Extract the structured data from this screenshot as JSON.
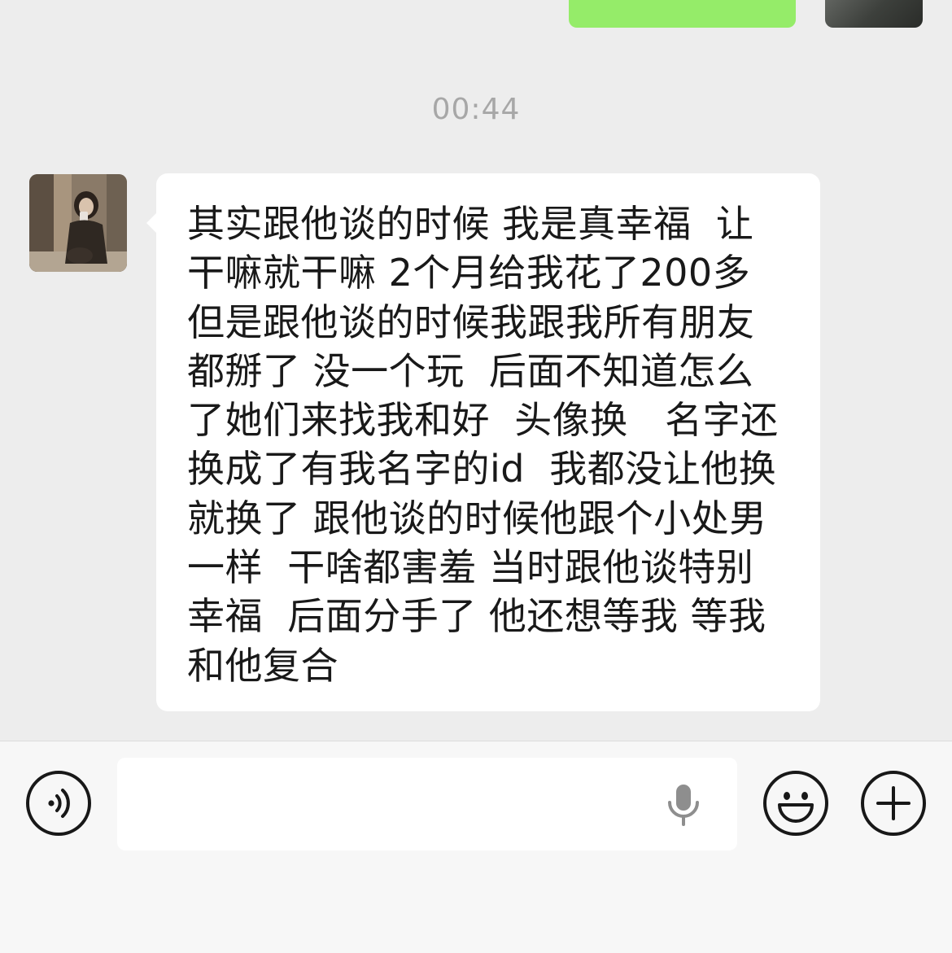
{
  "chat": {
    "timestamp": "00:44",
    "received_message": {
      "lines": [
        "其实跟他谈的时候 我是真幸福  让",
        "干嘛就干嘛 2个月给我花了200多",
        "但是跟他谈的时候我跟我所有朋友",
        "都掰了 没一个玩  后面不知道怎么",
        "了她们来找我和好  头像换   名字还",
        "换成了有我名字的id  我都没让他换",
        "就换了 跟他谈的时候他跟个小处男",
        "一样  干啥都害羞 当时跟他谈特别",
        "幸福  后面分手了 他还想等我 等我",
        "和他复合"
      ]
    }
  },
  "input_bar": {
    "voice_icon": "voice-mode-icon",
    "mic_icon": "microphone-icon",
    "emoji_icon": "emoji-icon",
    "plus_icon": "plus-icon",
    "text_value": ""
  },
  "colors": {
    "chat_background": "#ededed",
    "sent_bubble": "#95ec69",
    "received_bubble": "#ffffff",
    "timestamp_text": "#a7a7a7"
  }
}
